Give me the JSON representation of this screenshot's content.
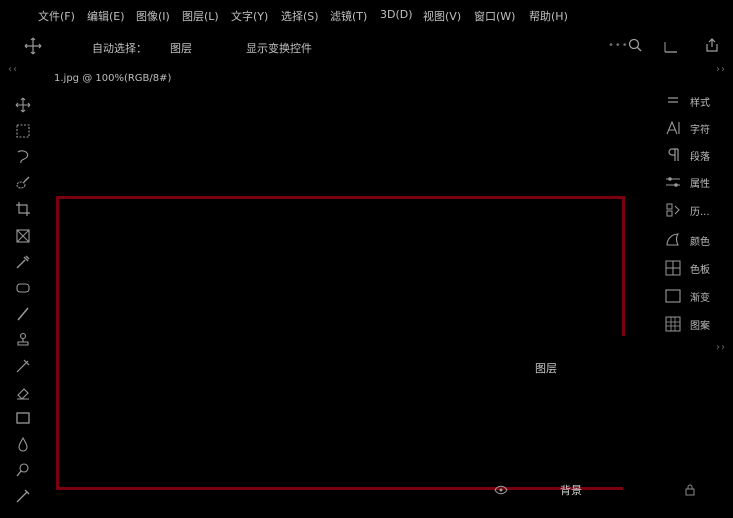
{
  "menubar": {
    "items": [
      "文件(F)",
      "编辑(E)",
      "图像(I)",
      "图层(L)",
      "文字(Y)",
      "选择(S)",
      "滤镜(T)",
      "3D(D)",
      "视图(V)",
      "窗口(W)",
      "帮助(H)"
    ]
  },
  "options": {
    "auto_select_label": "自动选择：",
    "auto_select_value": "图层",
    "show_transform_label": "显示变换控件"
  },
  "document": {
    "tab_title": "1.jpg @ 100%(RGB/8#)"
  },
  "right_panels": {
    "items": [
      {
        "label": "样式",
        "icon": "styles-icon"
      },
      {
        "label": "字符",
        "icon": "character-icon"
      },
      {
        "label": "段落",
        "icon": "paragraph-icon"
      },
      {
        "label": "属性",
        "icon": "properties-icon"
      },
      {
        "label": "历...",
        "icon": "history-icon"
      },
      {
        "label": "颜色",
        "icon": "color-icon"
      },
      {
        "label": "色板",
        "icon": "swatches-icon"
      },
      {
        "label": "渐变",
        "icon": "gradients-icon"
      },
      {
        "label": "图案",
        "icon": "patterns-icon"
      }
    ]
  },
  "layers": {
    "tab_label": "图层",
    "row_name": "背景"
  },
  "colors": {
    "canvas_border": "#7a0010",
    "background": "#000000",
    "text": "#c8c8c8"
  }
}
